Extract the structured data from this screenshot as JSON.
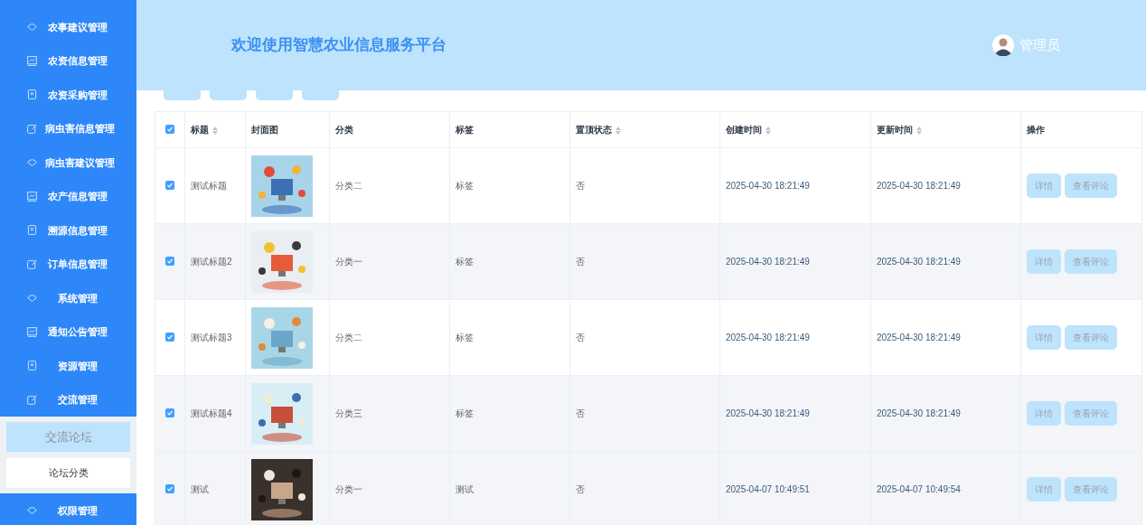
{
  "sidebar": {
    "items": [
      {
        "label": "农事建议管理"
      },
      {
        "label": "农资信息管理"
      },
      {
        "label": "农资采购管理"
      },
      {
        "label": "病虫害信息管理"
      },
      {
        "label": "病虫害建议管理"
      },
      {
        "label": "农产信息管理"
      },
      {
        "label": "溯源信息管理"
      },
      {
        "label": "订单信息管理"
      },
      {
        "label": "系统管理"
      },
      {
        "label": "通知公告管理"
      },
      {
        "label": "资源管理"
      },
      {
        "label": "交流管理",
        "children": [
          {
            "label": "交流论坛",
            "selected": true
          },
          {
            "label": "论坛分类",
            "selected": false
          }
        ]
      },
      {
        "label": "权限管理"
      }
    ]
  },
  "header": {
    "title": "欢迎使用智慧农业信息服务平台",
    "user": "管理员"
  },
  "table": {
    "all_checked": true,
    "columns": [
      {
        "label": "标题",
        "sortable": true
      },
      {
        "label": "封面图",
        "sortable": false
      },
      {
        "label": "分类",
        "sortable": false
      },
      {
        "label": "标签",
        "sortable": false
      },
      {
        "label": "置顶状态",
        "sortable": true
      },
      {
        "label": "创建时间",
        "sortable": true
      },
      {
        "label": "更新时间",
        "sortable": true
      },
      {
        "label": "操作",
        "sortable": false
      }
    ],
    "rows": [
      {
        "checked": true,
        "highlighted": false,
        "title": "测试标题",
        "category": "分类二",
        "tag": "标签",
        "pinned": "否",
        "created": "2025-04-30 18:21:49",
        "updated": "2025-04-30 18:21:49",
        "actions": [
          "详情",
          "查看评论"
        ]
      },
      {
        "checked": true,
        "highlighted": true,
        "title": "测试标题2",
        "category": "分类一",
        "tag": "标签",
        "pinned": "否",
        "created": "2025-04-30 18:21:49",
        "updated": "2025-04-30 18:21:49",
        "actions": [
          "详情",
          "查看评论"
        ]
      },
      {
        "checked": true,
        "highlighted": false,
        "title": "测试标题3",
        "category": "分类二",
        "tag": "标签",
        "pinned": "否",
        "created": "2025-04-30 18:21:49",
        "updated": "2025-04-30 18:21:49",
        "actions": [
          "详情",
          "查看评论"
        ]
      },
      {
        "checked": true,
        "highlighted": true,
        "title": "测试标题4",
        "category": "分类三",
        "tag": "标签",
        "pinned": "否",
        "created": "2025-04-30 18:21:49",
        "updated": "2025-04-30 18:21:49",
        "actions": [
          "详情",
          "查看评论"
        ]
      },
      {
        "checked": true,
        "highlighted": true,
        "title": "测试",
        "category": "分类一",
        "tag": "测试",
        "pinned": "否",
        "created": "2025-04-07 10:49:51",
        "updated": "2025-04-07 10:49:54",
        "actions": [
          "详情",
          "查看评论"
        ]
      }
    ]
  }
}
